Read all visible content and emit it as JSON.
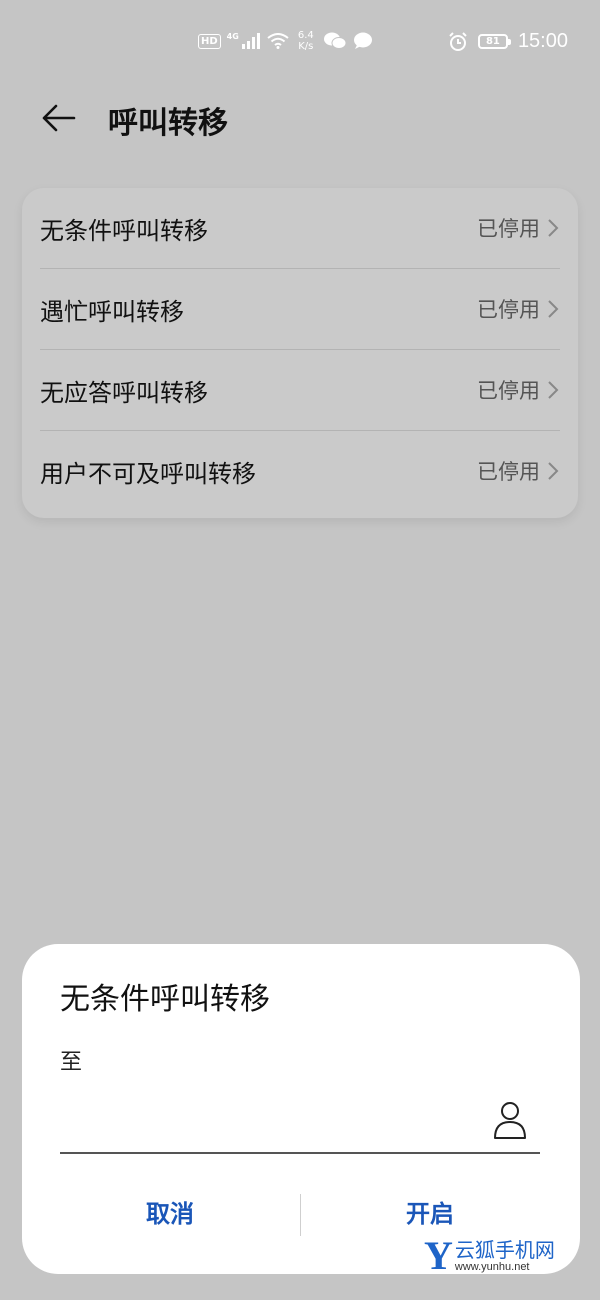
{
  "status_bar": {
    "hd": "HD",
    "network": "4G",
    "speed_value": "6.4",
    "speed_unit": "K/s",
    "battery": "81",
    "time": "15:00",
    "icons": [
      "signal-icon",
      "wifi-icon",
      "wechat-icon",
      "message-icon",
      "alarm-icon",
      "battery-icon"
    ]
  },
  "header": {
    "title": "呼叫转移"
  },
  "settings": {
    "items": [
      {
        "label": "无条件呼叫转移",
        "value": "已停用"
      },
      {
        "label": "遇忙呼叫转移",
        "value": "已停用"
      },
      {
        "label": "无应答呼叫转移",
        "value": "已停用"
      },
      {
        "label": "用户不可及呼叫转移",
        "value": "已停用"
      }
    ]
  },
  "dialog": {
    "title": "无条件呼叫转移",
    "to_label": "至",
    "input_value": "",
    "cancel_label": "取消",
    "confirm_label": "开启"
  },
  "watermark": {
    "letter": "Y",
    "name": "云狐手机网",
    "url": "www.yunhu.net"
  },
  "colors": {
    "background": "#c5c5c5",
    "dialog_bg": "#ffffff",
    "accent": "#1a56b8"
  }
}
